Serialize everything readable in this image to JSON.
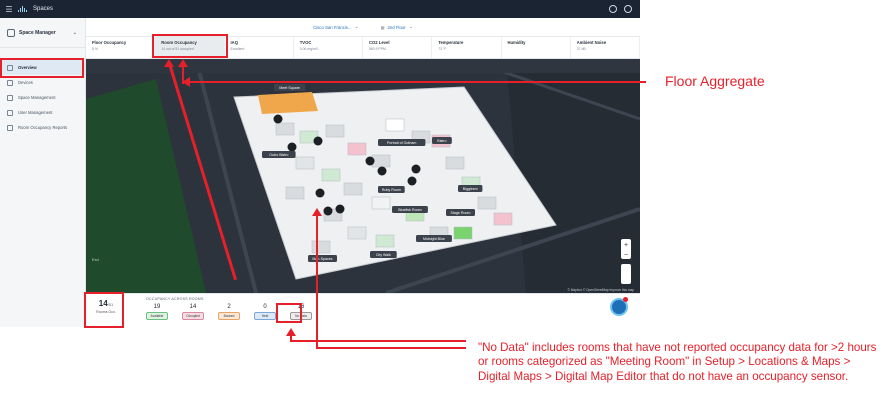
{
  "topbar": {
    "app_name": "Spaces"
  },
  "subbar": {
    "location": "Cisco San Francis...",
    "floor": "2nd Floor"
  },
  "sidebar": {
    "workspace": "Space Manager",
    "items": [
      {
        "label": "Overview",
        "active": true
      },
      {
        "label": "Devices",
        "active": false
      },
      {
        "label": "Space Management",
        "active": false
      },
      {
        "label": "User Management",
        "active": false
      },
      {
        "label": "Room Occupancy Reports",
        "active": false
      }
    ]
  },
  "metrics": [
    {
      "label": "Floor Occupancy",
      "value": "8 %"
    },
    {
      "label": "Room Occupancy",
      "value": "14 out of 51 occupied"
    },
    {
      "label": "IAQ",
      "value": "Excellent"
    },
    {
      "label": "TVOC",
      "value": "0.06 mg/m3"
    },
    {
      "label": "CO2 Level",
      "value": "560.9 PPM"
    },
    {
      "label": "Temperature",
      "value": "73 °F"
    },
    {
      "label": "Humidity",
      "value": ""
    },
    {
      "label": "Ambient Noise",
      "value": "37 dB"
    }
  ],
  "map": {
    "labels": [
      "Meet Square",
      "Portrait of Gotham",
      "Bistro",
      "Outro Bistro",
      "Ruby Room",
      "Bluefish Room",
      "Stage Room",
      "Man-Spaces",
      "Biggiesm",
      "Midnight Blue",
      "City Walk"
    ],
    "water_marker": "Esri",
    "attribution": "© Mapbox © OpenStreetMap  Improve this map"
  },
  "bottom": {
    "room_count": "14",
    "room_count_total": "/51",
    "room_caption": "Rooms Occ.",
    "occupancy_title": "OCCUPANCY ACROSS ROOMS",
    "stats": [
      {
        "value": "19",
        "label": "Available",
        "color": "#dff3e3",
        "border": "#6cbf7e"
      },
      {
        "value": "14",
        "label": "Occupied",
        "color": "#f6dde4",
        "border": "#d98aa0"
      },
      {
        "value": "2",
        "label": "Booked",
        "color": "#fde9d6",
        "border": "#e3a466"
      },
      {
        "value": "0",
        "label": "Held",
        "color": "#dceaf8",
        "border": "#7aa7d6"
      },
      {
        "value": "16",
        "label": "No Data",
        "color": "#ededed",
        "border": "#999999"
      }
    ]
  },
  "annotations": {
    "floor_aggregate": "Floor Aggregate",
    "no_data_note": "\"No Data\" includes rooms that have not reported occupancy data for >2 hours or rooms categorized as \"Meeting Room\" in Setup > Locations & Maps > Digital Maps > Digital Map Editor that do not have an occupancy sensor."
  },
  "colors": {
    "accent_red": "#e6202a",
    "topbar": "#1b2433"
  }
}
